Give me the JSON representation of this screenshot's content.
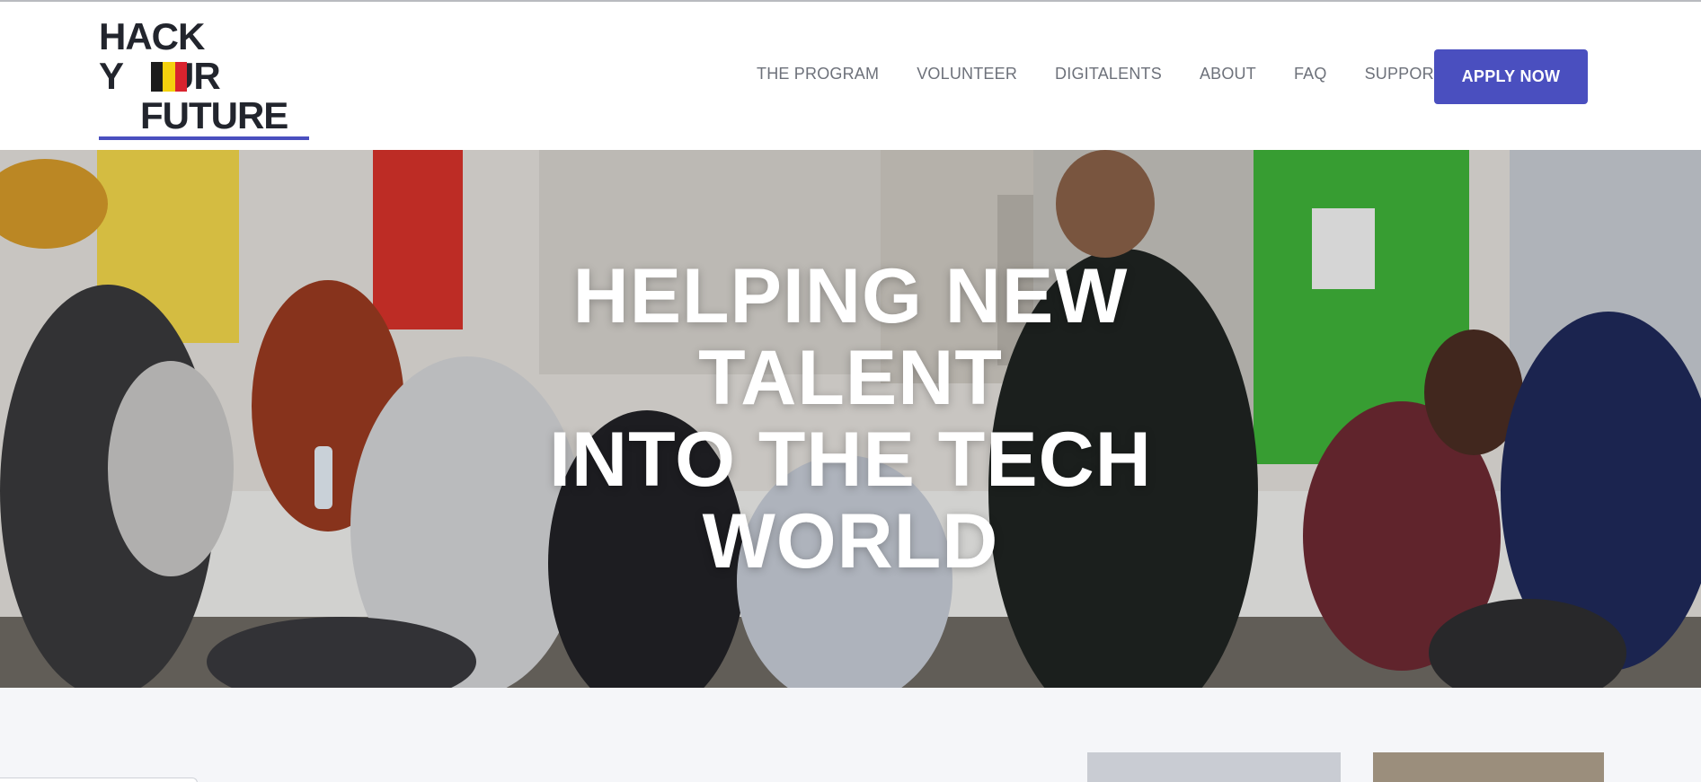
{
  "brand": {
    "logo_line1": "HACK",
    "logo_line2a": "Y",
    "logo_line2b": "UR",
    "logo_line3": "FUTURE",
    "accent_color": "#4a4fbf",
    "flag_colors": [
      "#1c1c1c",
      "#f4d10e",
      "#d9232e"
    ]
  },
  "nav": {
    "items": [
      {
        "label": "THE PROGRAM"
      },
      {
        "label": "VOLUNTEER"
      },
      {
        "label": "DIGITALENTS"
      },
      {
        "label": "ABOUT"
      },
      {
        "label": "FAQ"
      },
      {
        "label": "SUPPORT US"
      }
    ],
    "cta_label": "APPLY NOW"
  },
  "hero": {
    "title_lines": [
      "HELPING NEW",
      "TALENT",
      "INTO THE TECH",
      "WORLD"
    ],
    "image_subject": "students-collaborating-at-tables-photo"
  }
}
